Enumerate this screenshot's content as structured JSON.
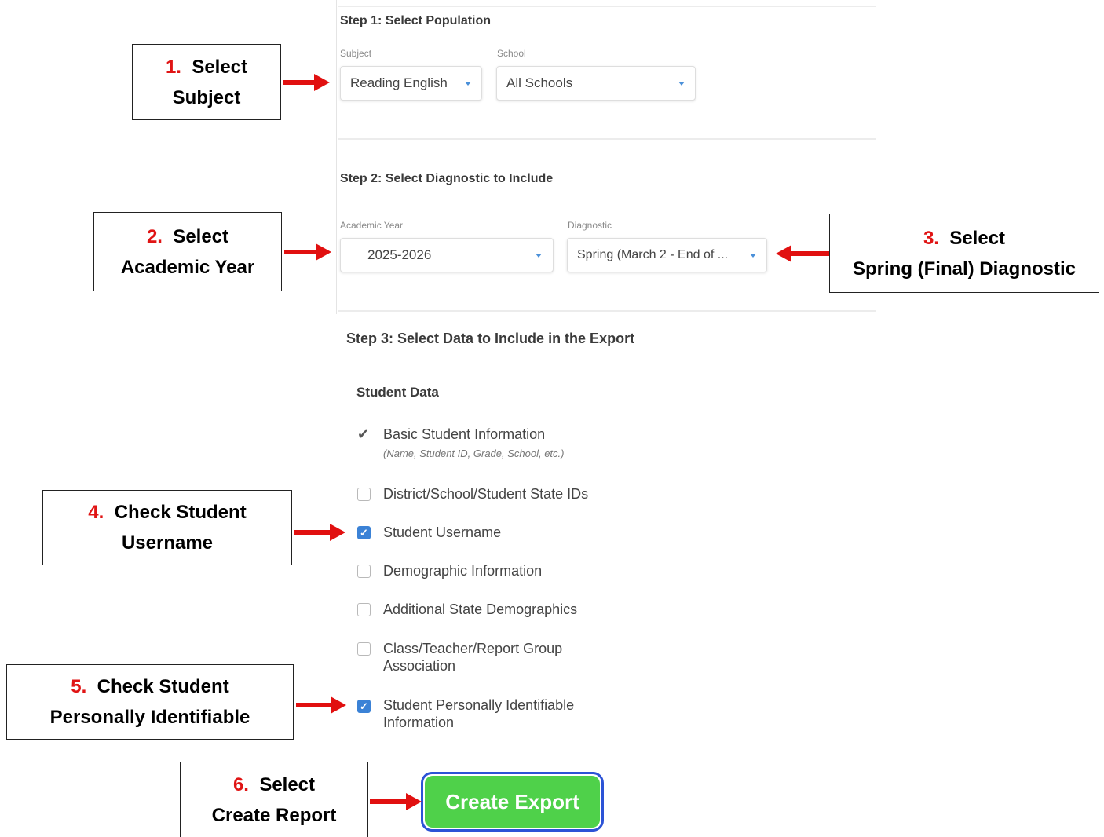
{
  "step1": {
    "title": "Step 1: Select Population",
    "subject_label": "Subject",
    "subject_value": "Reading English",
    "school_label": "School",
    "school_value": "All Schools"
  },
  "step2": {
    "title": "Step 2: Select Diagnostic to Include",
    "year_label": "Academic Year",
    "year_value": "2025-2026",
    "diag_label": "Diagnostic",
    "diag_value": "Spring (March 2 - End of ..."
  },
  "step3": {
    "title": "Step 3: Select Data to Include in the Export",
    "section": "Student Data",
    "options": [
      {
        "label": "Basic Student Information",
        "hint": "(Name, Student ID, Grade, School, etc.)",
        "state": "fixed"
      },
      {
        "label": "District/School/Student State IDs",
        "state": "unchecked"
      },
      {
        "label": "Student Username",
        "state": "checked"
      },
      {
        "label": "Demographic Information",
        "state": "unchecked"
      },
      {
        "label": "Additional State Demographics",
        "state": "unchecked"
      },
      {
        "label": "Class/Teacher/Report Group",
        "label2": "Association",
        "state": "unchecked"
      },
      {
        "label": "Student Personally Identifiable",
        "label2": "Information",
        "state": "checked"
      }
    ],
    "button": "Create Export"
  },
  "callouts": [
    {
      "num": "1.",
      "line1": "Select",
      "line2": "Subject"
    },
    {
      "num": "2.",
      "line1": "Select",
      "line2": "Academic Year"
    },
    {
      "num": "3.",
      "line1": "Select",
      "line2": "Spring (Final) Diagnostic"
    },
    {
      "num": "4.",
      "line1": "Check Student",
      "line2": "Username"
    },
    {
      "num": "5.",
      "line1": "Check Student",
      "line2": "Personally Identifiable"
    },
    {
      "num": "6.",
      "line1": "Select",
      "line2": "Create Report"
    }
  ],
  "colors": {
    "accent_red": "#e11010",
    "button_green": "#4fd14a",
    "button_border": "#2c53d6",
    "checkbox_blue": "#3b82d6"
  }
}
